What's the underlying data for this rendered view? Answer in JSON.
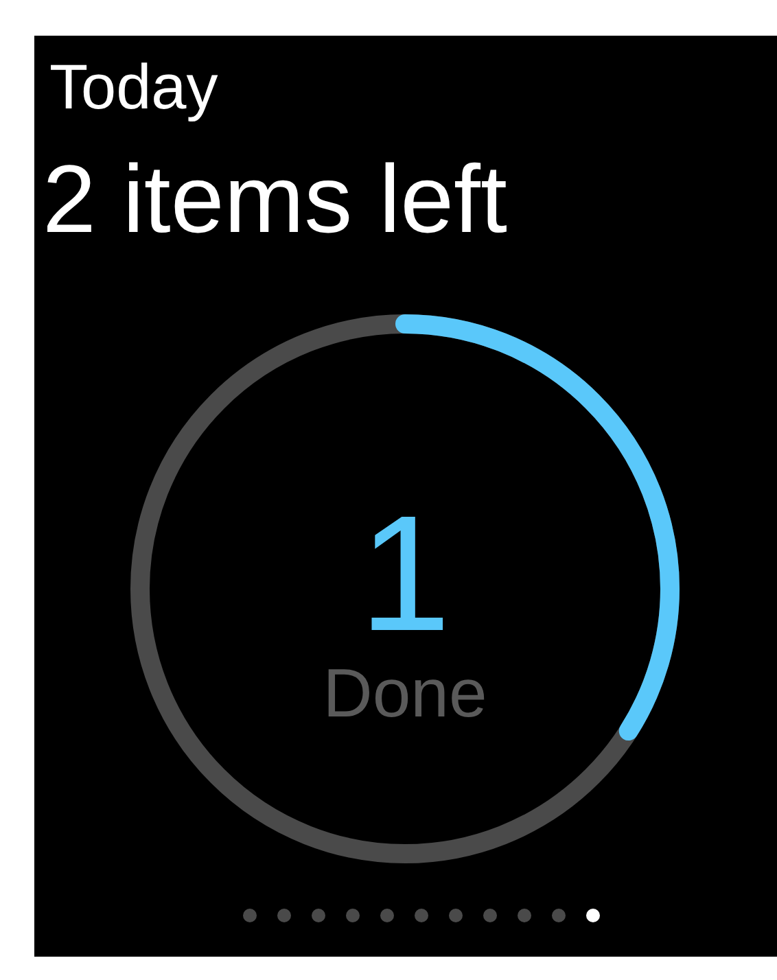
{
  "header": {
    "title": "Today",
    "subtitle": "2 items left"
  },
  "progress": {
    "count": "1",
    "label": "Done"
  },
  "pages": [
    {
      "selected": false
    },
    {
      "selected": false
    },
    {
      "selected": false
    },
    {
      "selected": false
    },
    {
      "selected": false
    },
    {
      "selected": false
    },
    {
      "selected": false
    },
    {
      "selected": false
    },
    {
      "selected": false
    },
    {
      "selected": false
    },
    {
      "selected": true
    }
  ]
}
